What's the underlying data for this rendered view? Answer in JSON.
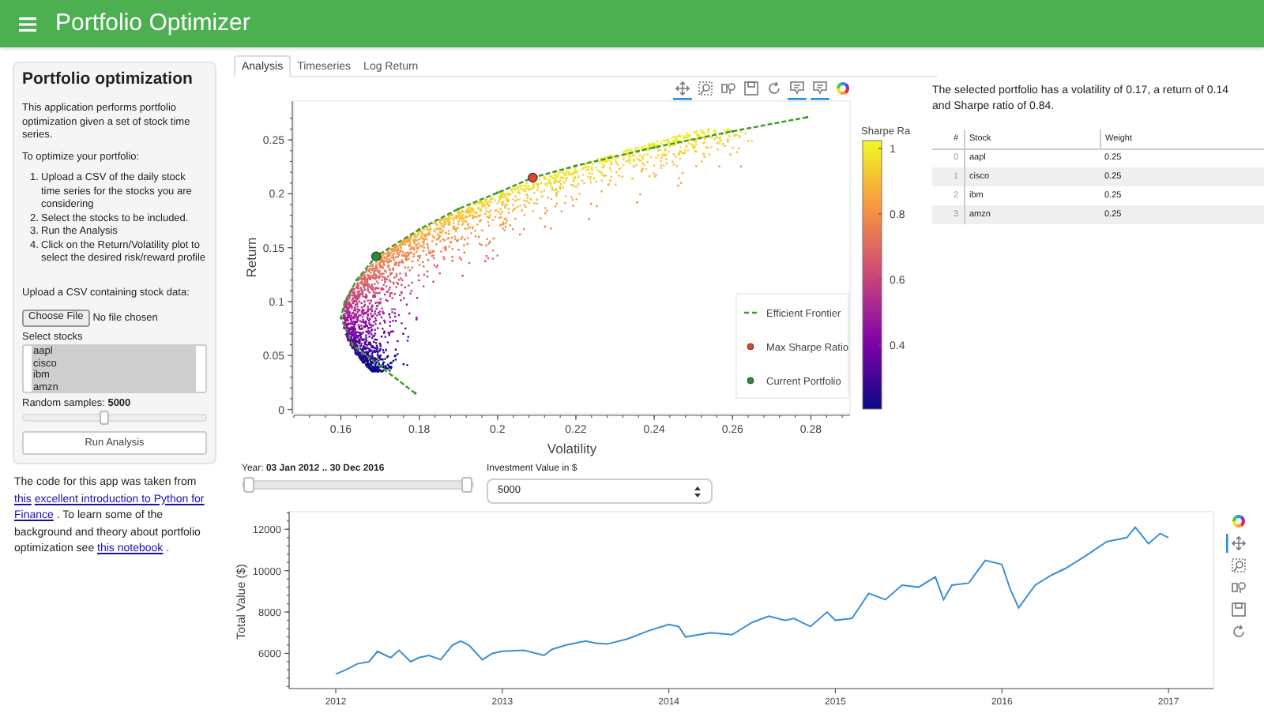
{
  "header": {
    "title": "Portfolio Optimizer"
  },
  "sidebar": {
    "title": "Portfolio optimization",
    "intro": "This application performs portfolio optimization given a set of stock time series.",
    "steps_heading": "To optimize your portfolio:",
    "steps": [
      {
        "number": "1.",
        "text": "Upload a CSV of the daily stock time series for the stocks you are considering"
      },
      {
        "number": "2.",
        "text": "Select the stocks to be included."
      },
      {
        "number": "3.",
        "text": "Run the Analysis"
      },
      {
        "number": "4.",
        "text": "Click on the Return/Volatility plot to select the desired risk/reward profile"
      }
    ],
    "upload_label": "Upload a CSV containing stock data:",
    "file_button": "Choose File",
    "file_status": "No file chosen",
    "select_label": "Select stocks",
    "stocks": [
      {
        "label": "aapl",
        "selected": true
      },
      {
        "label": "cisco",
        "selected": true
      },
      {
        "label": "ibm",
        "selected": true
      },
      {
        "label": "amzn",
        "selected": true
      }
    ],
    "samples_label": "Random samples: **5000**",
    "samples_slider": {
      "level": 0.44
    },
    "run_button": "Run Analysis"
  },
  "credits": [
    {
      "kind": "text",
      "text": "The code for this app was taken from "
    },
    {
      "kind": "link",
      "text": "this"
    },
    {
      "kind": "link",
      "text": "excellent introduction to Python for"
    },
    {
      "kind": "link",
      "text": "Finance"
    },
    {
      "kind": "text",
      "text": ". To learn some of the background and theory about portfolio optimization see "
    },
    {
      "kind": "link",
      "text": "this notebook"
    },
    {
      "kind": "text",
      "text": "."
    }
  ],
  "tabs": [
    {
      "label": "Analysis",
      "selected": true
    },
    {
      "label": "Timeseries",
      "selected": false
    },
    {
      "label": "Log Return",
      "selected": false
    }
  ],
  "scatter_toolbar": [
    {
      "kind": "pan",
      "active": true
    },
    {
      "kind": "box_zoom",
      "active": false
    },
    {
      "kind": "wheel_zoom",
      "active": false
    },
    {
      "kind": "save",
      "active": false
    },
    {
      "kind": "reset",
      "active": false
    },
    {
      "kind": "hover",
      "active": true
    },
    {
      "kind": "hover",
      "active": true
    },
    {
      "kind": "logo",
      "active": false
    }
  ],
  "scatter": {
    "chart_data": {
      "type": "line",
      "legend": "lower right",
      "xlabel": "Volatility",
      "ylabel": "Return",
      "xlim": [
        0.148,
        0.29
      ],
      "ylim": [
        -0.004,
        0.286
      ],
      "xticks": [
        {
          "value": 0.16,
          "label": "0.16"
        },
        {
          "value": 0.18,
          "label": "0.18"
        },
        {
          "value": 0.2,
          "label": "0.2"
        },
        {
          "value": 0.22,
          "label": "0.22"
        },
        {
          "value": 0.24,
          "label": "0.24"
        },
        {
          "value": 0.26,
          "label": "0.26"
        },
        {
          "value": 0.28,
          "label": "0.28"
        }
      ],
      "yticks": [
        {
          "value": 0,
          "label": "0"
        },
        {
          "value": 0.05,
          "label": "0.05"
        },
        {
          "value": 0.1,
          "label": "0.1"
        },
        {
          "value": 0.15,
          "label": "0.15"
        },
        {
          "value": 0.2,
          "label": "0.2"
        },
        {
          "value": 0.25,
          "label": "0.25"
        }
      ],
      "x": [
        0.179,
        0.17,
        0.163,
        0.16,
        0.161,
        0.164,
        0.169,
        0.18,
        0.19,
        0.2,
        0.209,
        0.22,
        0.24,
        0.26,
        0.279
      ],
      "series": [
        {
          "name": "Efficient Frontier",
          "color": "#3a9a2a",
          "line_style": "dashed",
          "values": [
            0.015,
            0.04,
            0.06,
            0.085,
            0.1,
            0.12,
            0.142,
            0.167,
            0.186,
            0.201,
            0.215,
            0.226,
            0.243,
            0.258,
            0.271
          ]
        },
        {
          "name": "Max Sharpe Ratio",
          "color": "#e0452c",
          "marker": "circle",
          "values": [
            null,
            null,
            null,
            null,
            null,
            null,
            null,
            null,
            null,
            null,
            0.215,
            null,
            null,
            null,
            null
          ]
        },
        {
          "name": "Current Portfolio",
          "color": "#2e8b2e",
          "marker": "circle",
          "values": [
            null,
            null,
            null,
            null,
            null,
            null,
            0.142,
            null,
            null,
            null,
            null,
            null,
            null,
            null,
            null
          ]
        }
      ]
    },
    "colorbar": {
      "title": "Sharpe Ra",
      "ticks": [
        "1",
        "0.8",
        "0.6",
        "0.4"
      ]
    }
  },
  "summary": "The selected portfolio has a volatility of 0.17, a return of 0.14 and Sharpe ratio of 0.84.",
  "weights_table": {
    "columns": [
      "#",
      "Stock",
      "Weight"
    ],
    "rows": [
      [
        "0",
        "aapl",
        "0.25"
      ],
      [
        "1",
        "cisco",
        "0.25"
      ],
      [
        "2",
        "ibm",
        "0.25"
      ],
      [
        "3",
        "amzn",
        "0.25"
      ]
    ]
  },
  "year_slider": {
    "label": "Year: **03 Jan 2012 .. 30 Dec 2016**",
    "handles": [
      {
        "level": 0
      },
      {
        "level": 1
      }
    ]
  },
  "investment": {
    "label": "Investment Value in $",
    "value": "5000"
  },
  "timeseries_toolbar": [
    {
      "kind": "logo",
      "active": false
    },
    {
      "kind": "pan",
      "active": true
    },
    {
      "kind": "box_zoom",
      "active": false
    },
    {
      "kind": "wheel_zoom",
      "active": false
    },
    {
      "kind": "save",
      "active": false
    },
    {
      "kind": "reset",
      "active": false
    }
  ],
  "timeseries": {
    "chart_data": {
      "type": "line",
      "ylabel": "Total Value ($)",
      "xlim": [
        2011.72,
        2017.27
      ],
      "ylim": [
        4300,
        12850
      ],
      "xticks": [
        {
          "value": 2012,
          "label": "2012"
        },
        {
          "value": 2013,
          "label": "2013"
        },
        {
          "value": 2014,
          "label": "2014"
        },
        {
          "value": 2015,
          "label": "2015"
        },
        {
          "value": 2016,
          "label": "2016"
        },
        {
          "value": 2017,
          "label": "2017"
        }
      ],
      "yticks": [
        {
          "value": 6000,
          "label": "6000"
        },
        {
          "value": 8000,
          "label": "8000"
        },
        {
          "value": 10000,
          "label": "10000"
        },
        {
          "value": 12000,
          "label": "12000"
        }
      ],
      "x": [
        2012.0,
        2012.06,
        2012.13,
        2012.2,
        2012.25,
        2012.3,
        2012.33,
        2012.38,
        2012.45,
        2012.5,
        2012.56,
        2012.63,
        2012.7,
        2012.75,
        2012.8,
        2012.88,
        2012.94,
        2013.0,
        2013.13,
        2013.25,
        2013.3,
        2013.38,
        2013.5,
        2013.56,
        2013.63,
        2013.75,
        2013.88,
        2014.0,
        2014.06,
        2014.1,
        2014.25,
        2014.38,
        2014.5,
        2014.6,
        2014.7,
        2014.75,
        2014.85,
        2014.95,
        2015.0,
        2015.1,
        2015.2,
        2015.3,
        2015.4,
        2015.5,
        2015.6,
        2015.65,
        2015.7,
        2015.8,
        2015.9,
        2016.0,
        2016.05,
        2016.1,
        2016.2,
        2016.3,
        2016.38,
        2016.5,
        2016.63,
        2016.75,
        2016.8,
        2016.88,
        2016.95,
        2017.0
      ],
      "series": [
        {
          "color": "#3a8fd6",
          "values": [
            5000,
            5200,
            5500,
            5600,
            6100,
            5900,
            5800,
            6150,
            5600,
            5800,
            5900,
            5700,
            6400,
            6600,
            6400,
            5700,
            6000,
            6100,
            6150,
            5900,
            6200,
            6400,
            6600,
            6500,
            6450,
            6700,
            7100,
            7400,
            7300,
            6800,
            7000,
            6900,
            7500,
            7800,
            7600,
            7700,
            7300,
            8000,
            7600,
            7700,
            8900,
            8600,
            9300,
            9200,
            9700,
            8600,
            9300,
            9400,
            10500,
            10300,
            9100,
            8200,
            9300,
            9800,
            10100,
            10700,
            11400,
            11600,
            12100,
            11300,
            11800,
            11600
          ]
        }
      ]
    }
  }
}
